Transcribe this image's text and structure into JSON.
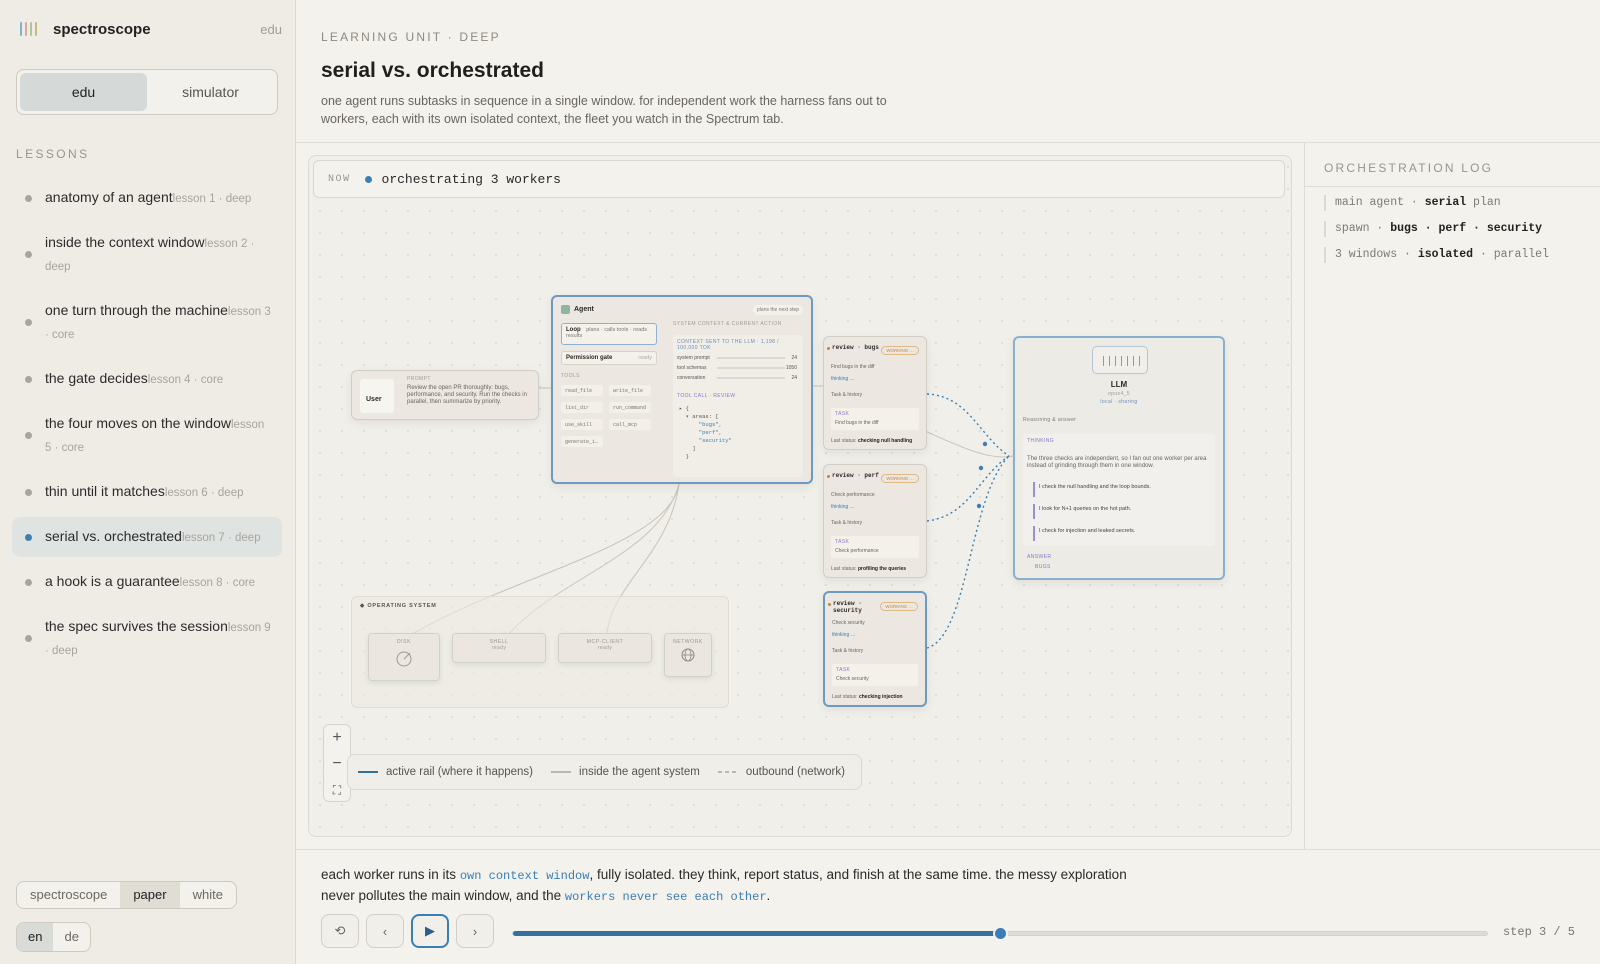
{
  "sidebar": {
    "brand": "spectroscope",
    "brand_mode": "edu",
    "brand_colors": [
      "#7eb4c8",
      "#d9a7a7",
      "#a9c79c",
      "#c9b97a"
    ],
    "mode_toggle": [
      "edu",
      "simulator"
    ],
    "lessons_title": "LESSONS",
    "lessons": [
      {
        "title": "anatomy of an agent",
        "meta": "lesson 1 · deep"
      },
      {
        "title": "inside the context window",
        "meta": "lesson 2 · deep"
      },
      {
        "title": "one turn through the machine",
        "meta": "lesson 3 · core"
      },
      {
        "title": "the gate decides",
        "meta": "lesson 4 · core"
      },
      {
        "title": "the four moves on the window",
        "meta": "lesson 5 · core"
      },
      {
        "title": "thin until it matches",
        "meta": "lesson 6 · deep"
      },
      {
        "title": "serial vs. orchestrated",
        "meta": "lesson 7 · deep"
      },
      {
        "title": "a hook is a guarantee",
        "meta": "lesson 8 · core"
      },
      {
        "title": "the spec survives the session",
        "meta": "lesson 9 · deep"
      }
    ],
    "active_lesson": "serial vs. orchestrated",
    "themes": [
      "spectroscope",
      "paper",
      "white"
    ],
    "active_theme": "paper",
    "languages": [
      "en",
      "de"
    ],
    "active_language": "en"
  },
  "header": {
    "eyebrow": "LEARNING UNIT · DEEP",
    "title": "serial vs. orchestrated",
    "description": "one agent runs subtasks in sequence in a single window. for independent work the harness fans out to workers, each with its own isolated context, the fleet you watch in the Spectrum tab."
  },
  "canvas": {
    "now_label": "NOW",
    "now_text": "orchestrating 3 workers",
    "user": {
      "title": "User",
      "sub": "PROMPT",
      "prompt_label": "PROMPT",
      "prompt_text": "Review the open PR thoroughly: bugs, performance, and security. Run the checks in parallel, then summarize by priority."
    },
    "agent": {
      "title": "Agent",
      "note": "plans the next step",
      "loop_label": "Loop",
      "loop_text": "plans · calls tools · reads results",
      "gate_label": "Permission gate",
      "gate_state": "ready",
      "tools_label": "TOOLS",
      "tools": [
        "read_file",
        "write_file",
        "list_dir",
        "run_command",
        "use_skill",
        "call_mcp",
        "generate_i…"
      ],
      "ctx_label": "SYSTEM CONTEXT & CURRENT ACTION",
      "ctx_sent": "CONTEXT SENT TO THE LLM · 1,198 / 100,000 TOK",
      "ctx_rows": [
        {
          "label": "system prompt",
          "value": "24"
        },
        {
          "label": "tool schemas",
          "value": "1050"
        },
        {
          "label": "conversation",
          "value": "24"
        }
      ],
      "tool_call_label": "TOOL CALL · REVIEW",
      "tool_call_code": [
        "▸ {",
        "  ▾ areas: [",
        "      \"bugs\",",
        "      \"perf\",",
        "      \"security\"",
        "    ]",
        "  }"
      ]
    },
    "workers": [
      {
        "name": "review · bugs",
        "badge": "WORKING …",
        "goal": "Find bugs in the diff",
        "thinking": "thinking …",
        "history": "Task & history",
        "task_label": "TASK",
        "task": "Find bugs in the diff",
        "status_label": "Last status:",
        "status": "checking null handling"
      },
      {
        "name": "review · perf",
        "badge": "WORKING …",
        "goal": "Check performance",
        "thinking": "thinking …",
        "history": "Task & history",
        "task_label": "TASK",
        "task": "Check performance",
        "status_label": "Last status:",
        "status": "profiling the queries"
      },
      {
        "name": "review · security",
        "badge": "WORKING …",
        "goal": "Check security",
        "thinking": "thinking …",
        "history": "Task & history",
        "task_label": "TASK",
        "task": "Check security",
        "status_label": "Last status:",
        "status": "checking injection"
      }
    ],
    "llm": {
      "name": "LLM",
      "sub": "opus4_5",
      "tag": "local · sharing",
      "section": "Reasoning & answer",
      "thinking_label": "THINKING",
      "thinking_text": "The three checks are independent, so I fan out one worker per area instead of grinding through them in one window.",
      "lines": [
        {
          "tag": "BUGS",
          "text": "I check the null handling and the loop bounds."
        },
        {
          "tag": "PERF",
          "text": "I look for N+1 queries on the hot path."
        },
        {
          "tag": "SECURITY",
          "text": "I check for injection and leaked secrets."
        }
      ],
      "answer_label": "ANSWER",
      "answer_tag": "BUGS"
    },
    "os": {
      "title": "OPERATING SYSTEM",
      "nodes": [
        {
          "name": "DISK",
          "state": ""
        },
        {
          "name": "SHELL",
          "state": "ready"
        },
        {
          "name": "MCP-CLIENT",
          "state": "ready"
        },
        {
          "name": "NETWORK",
          "state": ""
        }
      ]
    },
    "zoom": [
      "+",
      "−",
      "⛶"
    ],
    "legend": [
      {
        "label": "active rail (where it happens)",
        "color": "#35709f"
      },
      {
        "label": "inside the agent system",
        "color": "#bdb8ae"
      },
      {
        "label": "outbound (network)",
        "color": "#bdb8ae"
      }
    ]
  },
  "log": {
    "title": "ORCHESTRATION LOG",
    "lines": [
      [
        "main agent · ",
        "serial",
        " plan"
      ],
      [
        "spawn · ",
        "bugs · perf · security",
        ""
      ],
      [
        "3 windows · ",
        "isolated",
        " · parallel"
      ]
    ]
  },
  "footer": {
    "narration": [
      {
        "t": "each worker runs in its "
      },
      {
        "t": "own context window",
        "code": true
      },
      {
        "t": ", fully isolated. they think, report status, and finish at the same time. the messy exploration never pollutes the main window, and the "
      },
      {
        "t": "workers never see each other",
        "code": true
      },
      {
        "t": "."
      }
    ],
    "controls": [
      "⟲",
      "‹",
      "▶",
      "›"
    ],
    "step": 3,
    "total_steps": 5,
    "progress": 0.5,
    "step_label": "step 3 / 5",
    "accent": "#3c7eb4"
  }
}
